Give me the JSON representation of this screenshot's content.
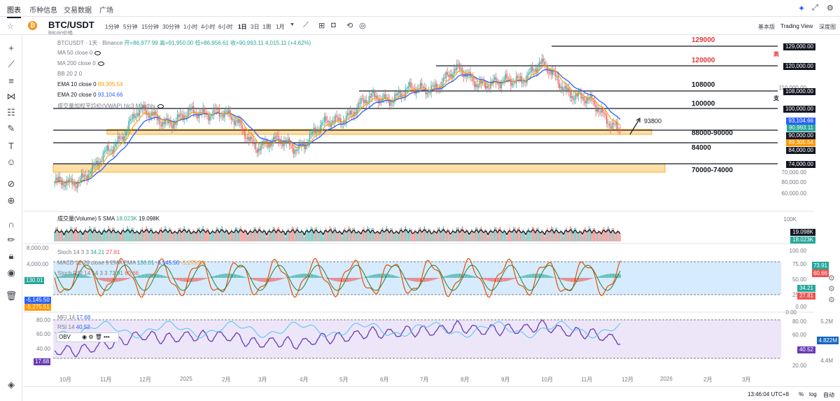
{
  "topnav": {
    "items": [
      "图表",
      "币种信息",
      "交易数据",
      "广场"
    ]
  },
  "toolbar": {
    "symbol": "BTC/USDT",
    "subtitle": "Bitcoin价格",
    "timeframes": [
      "1分钟",
      "5分钟",
      "15分钟",
      "30分钟",
      "1小时",
      "4小时",
      "6小时",
      "1日",
      "3日",
      "1周",
      "1月"
    ],
    "active_timeframe": "1日",
    "views": [
      "基本版",
      "Trading View",
      "深度图"
    ]
  },
  "legend": {
    "main_title": "BTCUSDT · 1天 · Binance",
    "open_label": "开",
    "open": "=86,977.99",
    "high_label": "高",
    "high": "=91,950.00",
    "low_label": "低",
    "low": "=86,956.61",
    "close_label": "收",
    "close": "=90,993.11",
    "change": "4,015.11 (+4.62%)",
    "ma50": "MA 50 close 0",
    "ma200": "MA 200 close 0",
    "bb": "BB 20 2 0",
    "ema10": "EMA 10 close 0",
    "ema10_val": "89,305.54",
    "ema20": "EMA 20 close 0",
    "ema20_val": "93,104.66",
    "vwap": "成交量加权平均价(VWAP) hlc3 Monthly",
    "volume": "成交量(Volume) 5 SMA",
    "vol_a": "18.023K",
    "vol_b": "19.098K",
    "stoch": "Stoch 14 3 3",
    "stoch_a": "34.21",
    "stoch_b": "27.81",
    "macd": "MACD 12 26 close 9 EMA EMA",
    "macd_a": "130.01",
    "macd_b": "-5,145.50",
    "macd_c": "-5,275.51",
    "stochrsi": "Stoch RSI 14 14 3 3",
    "stochrsi_a": "73.91",
    "stochrsi_b": "60.66",
    "mfi": "MFI 14",
    "mfi_v": "17.68",
    "rsi": "RSI 14",
    "rsi_v": "40.52",
    "obv": "OBV"
  },
  "annotations": {
    "r129": "129000",
    "r120": "120000",
    "r108": "108000",
    "r100": "100000",
    "p93800": "93800",
    "z88": "88000-90000",
    "s84": "84000",
    "z70": "70000-74000",
    "high_word": "高",
    "support_word": "支"
  },
  "price_tags": [
    {
      "text": "129,000.00",
      "bg": "#131722"
    },
    {
      "text": "120,000.00",
      "bg": "#131722"
    },
    {
      "text": "108,000.00",
      "bg": "#131722"
    },
    {
      "text": "100,000.00",
      "bg": "#131722"
    },
    {
      "text": "93,104.66",
      "bg": "#2962ff"
    },
    {
      "text": "90,993.11",
      "bg": "#26a69a"
    },
    {
      "text": "90,000.00",
      "bg": "#131722"
    },
    {
      "text": "89,305.54",
      "bg": "#ff9800"
    },
    {
      "text": "84,000.00",
      "bg": "#131722"
    },
    {
      "text": "74,000.00",
      "bg": "#131722"
    },
    {
      "text": "19.098K",
      "bg": "#131722"
    },
    {
      "text": "18.023K",
      "bg": "#26a69a"
    }
  ],
  "price_axis": [
    "110,000.00",
    "80,000.00",
    "70,000.00",
    "60,000.00",
    "100K",
    "0.00"
  ],
  "osc_axis": [
    "100.00",
    "75.00",
    "50.00",
    "25.00",
    "0.00"
  ],
  "rsi_axis": [
    "80.00",
    "60.00",
    "40.00",
    "20.00"
  ],
  "obv_axis": [
    "5.2M",
    "4.822M",
    "4.4M"
  ],
  "osc_tags": {
    "a": "73.91",
    "b": "60.66",
    "c": "34.21",
    "d": "27.81",
    "e": "40.52",
    "f": "4.822M"
  },
  "left_axis": [
    "8,000.00",
    "4,000.00",
    "130.01",
    "-5,145.50",
    "-5,275.51",
    "80.00",
    "60.00",
    "40.00",
    "17.68"
  ],
  "x_axis": [
    "10月",
    "11月",
    "12月",
    "2025",
    "2月",
    "3月",
    "4月",
    "5月",
    "6月",
    "7月",
    "8月",
    "9月",
    "10月",
    "11月",
    "12月",
    "2026",
    "2月",
    "3月"
  ],
  "bottom": {
    "time": "13:46:04 UTC+8",
    "pct": "%",
    "log": "log",
    "auto": "自动"
  },
  "chart_data": {
    "type": "line",
    "title": "BTCUSDT · 1天 · Binance",
    "x": [
      "10月",
      "11月",
      "12月",
      "2025",
      "2月",
      "3月",
      "4月",
      "5月",
      "6月",
      "7月",
      "8月",
      "9月",
      "10月",
      "11月",
      "12月"
    ],
    "series": [
      {
        "name": "BTCUSDT",
        "values": [
          62000,
          70000,
          97000,
          94000,
          100000,
          83000,
          82000,
          95000,
          105000,
          108000,
          117000,
          110000,
          120000,
          105000,
          91000
        ]
      }
    ],
    "ylim": [
      58000,
      132000
    ],
    "levels": [
      129000,
      120000,
      108000,
      100000,
      90000,
      84000,
      74000
    ],
    "zones": [
      [
        88000,
        90000
      ],
      [
        70000,
        74000
      ]
    ]
  }
}
